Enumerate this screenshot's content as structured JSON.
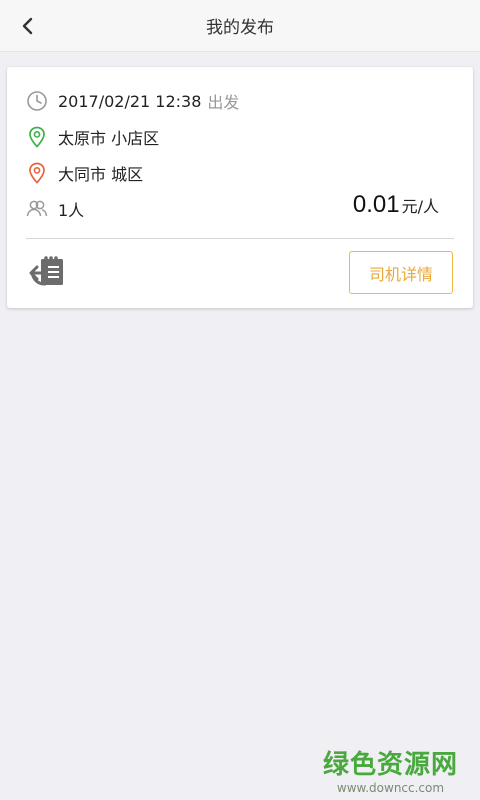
{
  "header": {
    "title": "我的发布",
    "back_icon": "chevron-left-icon"
  },
  "trip": {
    "datetime": "2017/02/21 12:38",
    "depart_label": "出发",
    "origin": "太原市 小店区",
    "destination": "大同市 城区",
    "passengers": "1人",
    "price_value": "0.01",
    "price_unit": "元/人",
    "driver_button": "司机详情",
    "icons": {
      "time": "clock-icon",
      "origin": "location-pin-icon",
      "destination": "location-pin-icon",
      "passengers": "people-icon",
      "note": "note-reply-icon"
    },
    "colors": {
      "origin_pin": "#3cb14a",
      "destination_pin": "#e8643c",
      "button_accent": "#f0b849"
    }
  },
  "watermark": {
    "title": "绿色资源网",
    "url": "www.downcc.com"
  }
}
